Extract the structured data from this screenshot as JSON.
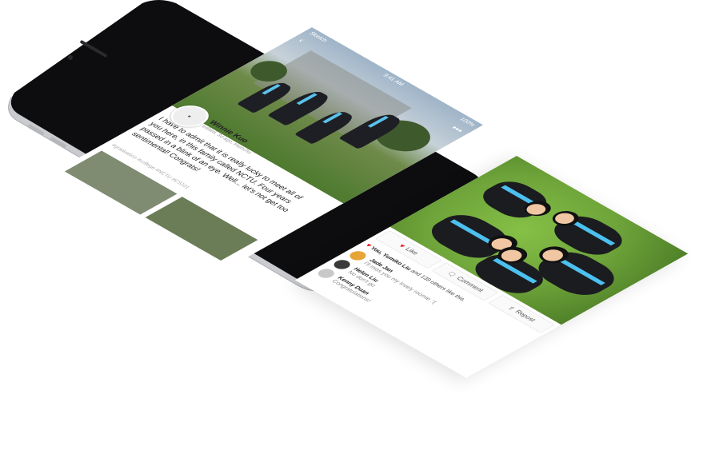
{
  "status_bar": {
    "carrier": "Sketch",
    "time": "9:41 AM",
    "battery": "100%"
  },
  "top_bar": {
    "back_icon": "chevron-left-icon",
    "more_icon": "more-dots-icon"
  },
  "post": {
    "author": "Winnie Kuo",
    "meta": "edited, 3d ago, Hsinchu",
    "text": "I have to admit that it is really lucky to meet all of you here, in this family called NCTU. Four years passed in a blink of an eye. Well... let's not get too sentimental! Congrats!",
    "tags": "#graduation #college #NCTU #CS101"
  },
  "actions": {
    "like": "Like",
    "comment": "Comment",
    "repost": "Repost"
  },
  "likes_summary": {
    "strong": "You, Yumiko Liu",
    "rest": " and 139 others like this."
  },
  "comments": [
    {
      "name": "Jade Jan",
      "text": "I'll miss you my lovely roomie :'(",
      "color": "#e6a536"
    },
    {
      "name": "Helen Liu",
      "text": "No don't go",
      "color": "#3a3a3a"
    },
    {
      "name": "Kenny Duan",
      "text": "Congratulations!",
      "color": "#c9c9c9"
    }
  ]
}
